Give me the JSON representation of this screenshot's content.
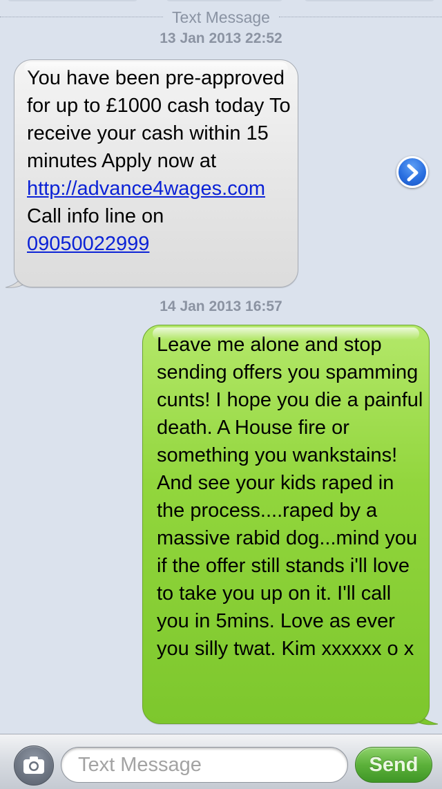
{
  "thread": {
    "divider_label": "Text Message",
    "messages": [
      {
        "timestamp": "13 Jan 2013 22:52",
        "direction": "incoming",
        "text_before_link": "You have been pre-approved for up to £1000 cash today To receive your cash within 15 minutes Apply now at ",
        "link": "http://advance4wages.com",
        "text_after_link": " Call info line on ",
        "phone": "09050022999"
      },
      {
        "timestamp": "14 Jan 2013 16:57",
        "direction": "outgoing",
        "text": "Leave me alone and stop sending offers you spamming cunts! I hope you die a painful death. A House fire or something you wankstains! And see your kids raped in the process....raped by a massive rabid dog...mind you if the offer still stands i'll love to take you up on it. I'll call you in 5mins. Love as ever you silly twat. Kim xxxxxx o x"
      }
    ]
  },
  "compose": {
    "placeholder": "Text Message",
    "value": "",
    "send_label": "Send",
    "camera_icon": "camera-icon"
  },
  "colors": {
    "background": "#dbe2ed",
    "incoming_bubble": "#e6e6e6",
    "outgoing_bubble": "#92d63d",
    "link": "#0b22d6",
    "send_button": "#5cb13a"
  }
}
